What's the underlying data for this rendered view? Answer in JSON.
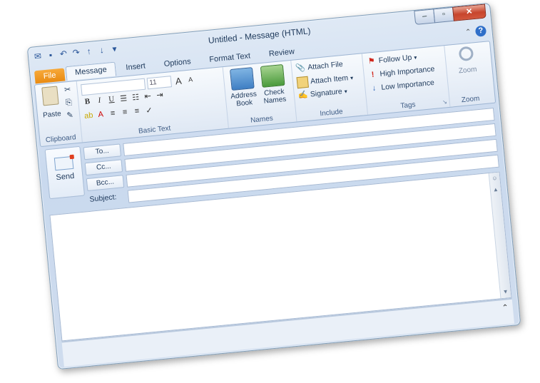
{
  "window": {
    "title": "Untitled - Message (HTML)"
  },
  "quick_access": [
    "save-icon",
    "undo-icon",
    "redo-icon",
    "up-arrow-icon",
    "down-arrow-icon",
    "customize-icon"
  ],
  "tabs": [
    "File",
    "Message",
    "Insert",
    "Options",
    "Format Text",
    "Review"
  ],
  "ribbon": {
    "clipboard": {
      "label": "Clipboard",
      "paste": "Paste"
    },
    "basic_text": {
      "label": "Basic Text",
      "font_size": "11"
    },
    "names": {
      "label": "Names",
      "address_book_1": "Address",
      "address_book_2": "Book",
      "check_names_1": "Check",
      "check_names_2": "Names"
    },
    "include": {
      "label": "Include",
      "attach_file": "Attach File",
      "attach_item": "Attach Item",
      "signature": "Signature"
    },
    "tags": {
      "label": "Tags",
      "follow_up": "Follow Up",
      "high_importance": "High Importance",
      "low_importance": "Low Importance"
    },
    "zoom": {
      "label": "Zoom",
      "zoom_button": "Zoom"
    }
  },
  "compose": {
    "send": "Send",
    "to": "To...",
    "cc": "Cc...",
    "bcc": "Bcc...",
    "subject": "Subject:"
  },
  "colors": {
    "file_tab": "#e98b12",
    "close_button": "#c7452d",
    "accent": "#2b579a"
  }
}
